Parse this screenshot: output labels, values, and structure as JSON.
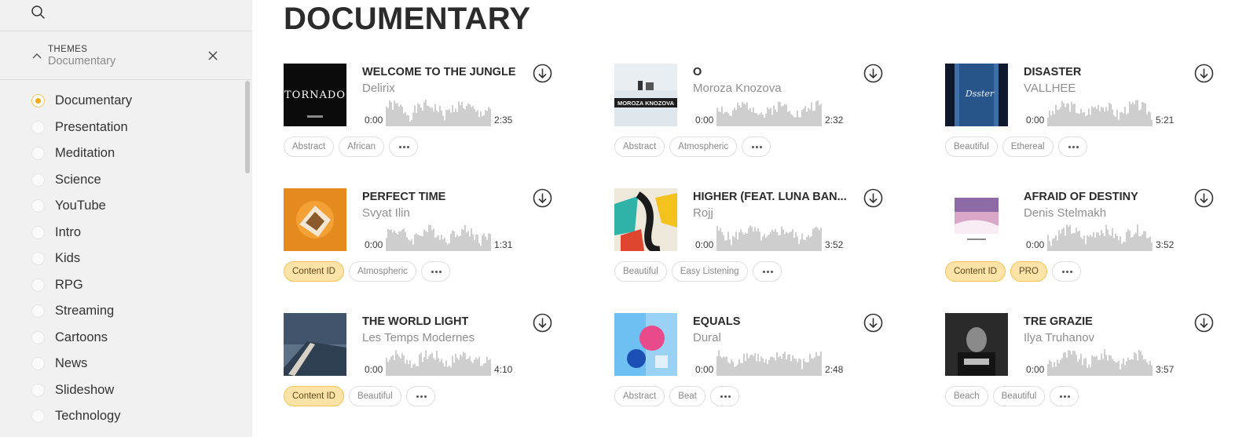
{
  "search": {
    "icon": "search-icon"
  },
  "filter": {
    "heading": "THEMES",
    "value": "Documentary"
  },
  "themes": [
    {
      "label": "Documentary",
      "selected": true
    },
    {
      "label": "Presentation",
      "selected": false
    },
    {
      "label": "Meditation",
      "selected": false
    },
    {
      "label": "Science",
      "selected": false
    },
    {
      "label": "YouTube",
      "selected": false
    },
    {
      "label": "Intro",
      "selected": false
    },
    {
      "label": "Kids",
      "selected": false
    },
    {
      "label": "RPG",
      "selected": false
    },
    {
      "label": "Streaming",
      "selected": false
    },
    {
      "label": "Cartoons",
      "selected": false
    },
    {
      "label": "News",
      "selected": false
    },
    {
      "label": "Slideshow",
      "selected": false
    },
    {
      "label": "Technology",
      "selected": false
    }
  ],
  "page": {
    "title": "DOCUMENTARY"
  },
  "tracks": [
    {
      "title": "WELCOME TO THE JUNGLE",
      "artist": "Delirix",
      "start": "0:00",
      "duration": "2:35",
      "tags": [
        {
          "label": "Abstract",
          "highlight": false
        },
        {
          "label": "African",
          "highlight": false
        }
      ],
      "cover": {
        "bg": "#0b0b0b",
        "accent": "#ffffff",
        "text": "TORNADO"
      }
    },
    {
      "title": "O",
      "artist": "Moroza Knozova",
      "start": "0:00",
      "duration": "2:32",
      "tags": [
        {
          "label": "Abstract",
          "highlight": false
        },
        {
          "label": "Atmospheric",
          "highlight": false
        }
      ],
      "cover": {
        "bg": "#dfe6ec",
        "accent": "#222222",
        "text": "MOROZA KNOZOVA"
      }
    },
    {
      "title": "DISASTER",
      "artist": "VALLHEE",
      "start": "0:00",
      "duration": "5:21",
      "tags": [
        {
          "label": "Beautiful",
          "highlight": false
        },
        {
          "label": "Ethereal",
          "highlight": false
        }
      ],
      "cover": {
        "bg": "#0e1a2c",
        "accent": "#3f6fa8",
        "text": "Dsster"
      }
    },
    {
      "title": "PERFECT TIME",
      "artist": "Svyat Ilin",
      "start": "0:00",
      "duration": "1:31",
      "tags": [
        {
          "label": "Content ID",
          "highlight": true
        },
        {
          "label": "Atmospheric",
          "highlight": false
        }
      ],
      "cover": {
        "bg": "#e48a1f",
        "accent": "#f3e6d2",
        "text": ""
      }
    },
    {
      "title": "HIGHER (FEAT. LUNA BAN...",
      "artist": "Rojj",
      "start": "0:00",
      "duration": "3:52",
      "tags": [
        {
          "label": "Beautiful",
          "highlight": false
        },
        {
          "label": "Easy Listening",
          "highlight": false
        }
      ],
      "cover": {
        "bg": "#efe9dc",
        "accent": "#1b1b1b",
        "text": ""
      }
    },
    {
      "title": "AFRAID OF DESTINY",
      "artist": "Denis Stelmakh",
      "start": "0:00",
      "duration": "3:52",
      "tags": [
        {
          "label": "Content ID",
          "highlight": true
        },
        {
          "label": "PRO",
          "highlight": true
        }
      ],
      "cover": {
        "bg": "#ffffff",
        "accent": "#b27fae",
        "text": ""
      }
    },
    {
      "title": "THE WORLD LIGHT",
      "artist": "Les Temps Modernes",
      "start": "0:00",
      "duration": "4:10",
      "tags": [
        {
          "label": "Content ID",
          "highlight": true
        },
        {
          "label": "Beautiful",
          "highlight": false
        }
      ],
      "cover": {
        "bg": "#5d7287",
        "accent": "#d8d2c6",
        "text": ""
      }
    },
    {
      "title": "EQUALS",
      "artist": "Dural",
      "start": "0:00",
      "duration": "2:48",
      "tags": [
        {
          "label": "Abstract",
          "highlight": false
        },
        {
          "label": "Beat",
          "highlight": false
        }
      ],
      "cover": {
        "bg": "#3f8fd0",
        "accent": "#e84a8a",
        "text": ""
      }
    },
    {
      "title": "TRE GRAZIE",
      "artist": "Ilya Truhanov",
      "start": "0:00",
      "duration": "3:57",
      "tags": [
        {
          "label": "Beach",
          "highlight": false
        },
        {
          "label": "Beautiful",
          "highlight": false
        }
      ],
      "cover": {
        "bg": "#2a2a2a",
        "accent": "#bdbdbd",
        "text": ""
      }
    }
  ]
}
